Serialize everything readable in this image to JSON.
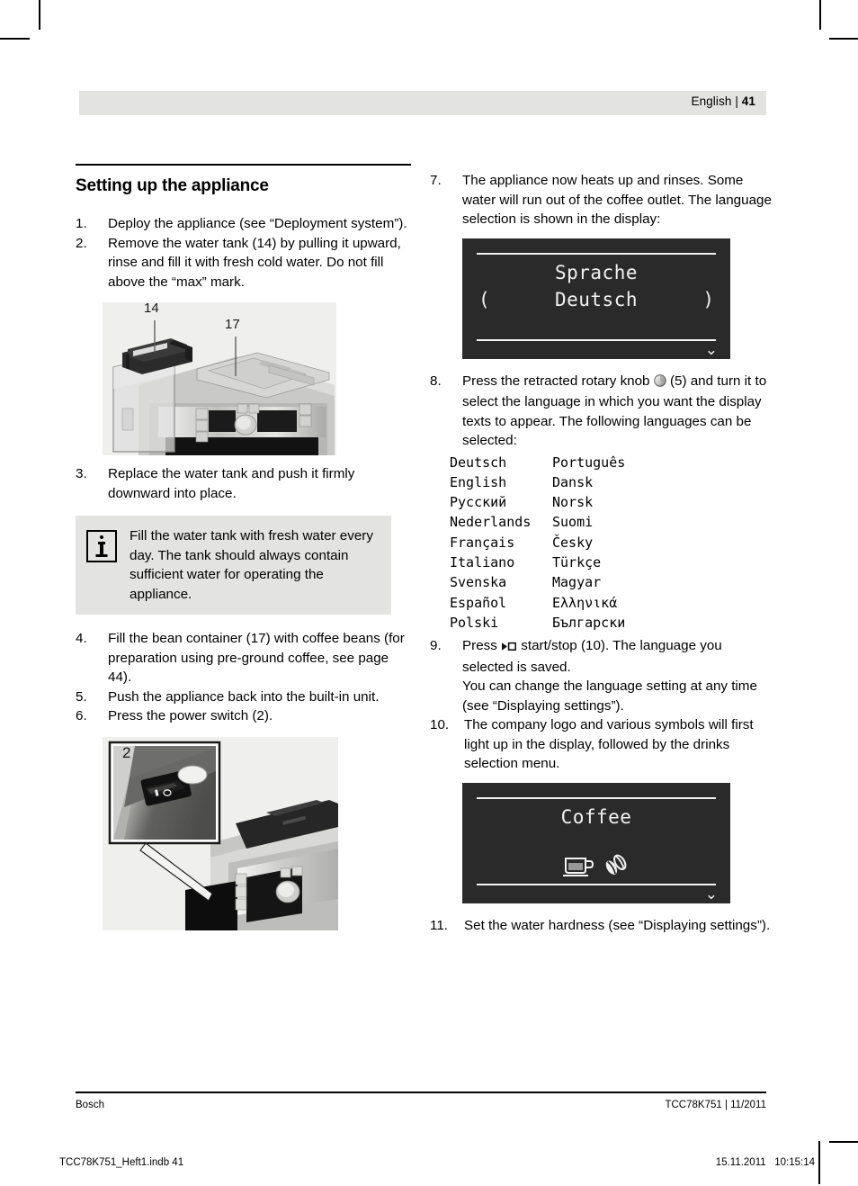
{
  "header": {
    "language_label": "English",
    "separator": "|",
    "page_number": "41"
  },
  "left_column": {
    "section_title": "Setting up the appliance",
    "steps": [
      {
        "num": "1.",
        "text": "Deploy the appliance (see “Deployment system”)."
      },
      {
        "num": "2.",
        "text": "Remove the water tank (14) by pulling it upward, rinse and fill it with fresh cold water. Do not fill above the “max” mark."
      },
      {
        "num": "3.",
        "text": "Replace the water tank and push it firmly downward into place."
      },
      {
        "num": "4.",
        "text": "Fill the bean container (17) with coffee beans (for preparation using pre-ground coffee, see page 44)."
      },
      {
        "num": "5.",
        "text": "Push the appliance back into the built-in unit."
      },
      {
        "num": "6.",
        "text": "Press the power switch (2)."
      }
    ],
    "note": {
      "icon": "info-icon",
      "text": "Fill the water tank with fresh water every day. The tank should always contain sufficient water for operating the appliance."
    },
    "figure_water_tank": {
      "callout_1": "14",
      "callout_2": "17"
    },
    "figure_power_switch": {
      "callout_1": "2"
    }
  },
  "right_column": {
    "steps": [
      {
        "num": "7.",
        "text": "The appliance now heats up and rinses. Some water will run out of the coffee outlet. The language selection is shown in the display:"
      },
      {
        "num": "8.",
        "text_before": "Press the retracted rotary knob ",
        "icon": "rotary-knob-icon",
        "text_after": " (5) and turn it to select the language in which you want the display texts to appear. The following languages can be selected:"
      },
      {
        "num": "9.",
        "text_before": "Press ",
        "icon": "start-stop-icon",
        "text_after": " start/stop (10). The language you selected is saved."
      },
      {
        "num": "10.",
        "text": "The company logo and various symbols will first light up in the display, followed by the drinks selection menu."
      },
      {
        "num": "11.",
        "text": "Set the water hardness (see “Displaying settings”)."
      }
    ],
    "step9_extra": "You can change the language setting at any time (see “Displaying settings”).",
    "display_language": {
      "title": "Sprache",
      "value": "Deutsch",
      "arrow_left": "(",
      "arrow_right": ")",
      "chevron": "⌄"
    },
    "display_coffee": {
      "title": "Coffee",
      "icon_cup": "coffee-cup-icon",
      "icon_beans": "coffee-beans-icon",
      "chevron": "⌄"
    },
    "languages": [
      [
        "Deutsch",
        "Português"
      ],
      [
        "English",
        "Dansk"
      ],
      [
        "Русский",
        "Norsk"
      ],
      [
        "Nederlands",
        "Suomi"
      ],
      [
        "Français",
        "Česky"
      ],
      [
        "Italiano",
        "Türkçe"
      ],
      [
        "Svenska",
        "Magyar"
      ],
      [
        "Español",
        "Ελληνικά"
      ],
      [
        "Polski",
        "Български"
      ]
    ]
  },
  "footer": {
    "brand": "Bosch",
    "doc_ref": "TCC78K751 | 11/2011"
  },
  "imprint": {
    "file": "TCC78K751_Heft1.indb   41",
    "timestamp": "15.11.2011   10:15:14"
  },
  "colors": {
    "band_gray": "#e3e3e1",
    "lcd_background": "#2a2a2a",
    "lcd_text": "#f2f2f2"
  }
}
